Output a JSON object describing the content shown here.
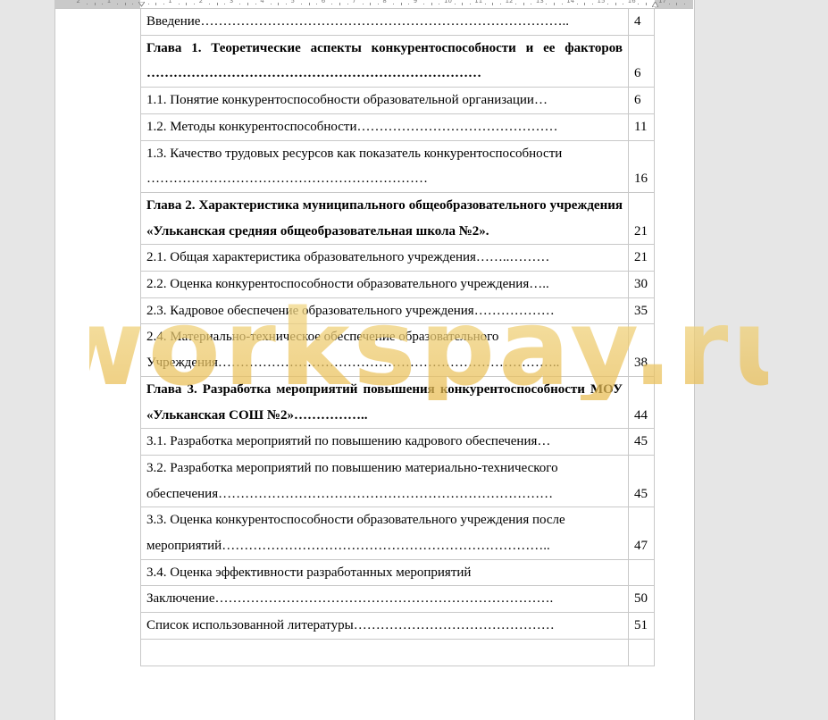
{
  "watermark": "workspay.ru",
  "ruler": {
    "numbers": [
      "2",
      "1",
      "1",
      "2",
      "3",
      "4",
      "5",
      "6",
      "7",
      "8",
      "9",
      "10",
      "11",
      "12",
      "13",
      "14",
      "15",
      "16",
      "17"
    ]
  },
  "toc": [
    {
      "text": "Введение………………………………………………………………………..",
      "page": "4",
      "bold": false,
      "tall": false
    },
    {
      "text": "Глава 1. Теоретические аспекты конкурентоспособности и ее факторов …………………………………………………………………",
      "page": "6",
      "bold": true,
      "tall": true
    },
    {
      "text": "1.1.    Понятие конкурентоспособности образовательной организации…",
      "page": "6",
      "bold": false,
      "tall": false
    },
    {
      "text": "1.2.    Методы конкурентоспособности………………………………………",
      "page": "11",
      "bold": false,
      "tall": false
    },
    {
      "text": "1.3.    Качество трудовых ресурсов как показатель конкурентоспособности ………………………………………………………",
      "page": "16",
      "bold": false,
      "tall": true
    },
    {
      "text": "Глава 2. Характеристика муниципального общеобразовательного учреждения «Ульканская средняя общеобразовательная школа №2».",
      "page": "21",
      "bold": true,
      "tall": true
    },
    {
      "text": "2.1.   Общая характеристика образовательного учреждения……..………",
      "page": "21",
      "bold": false,
      "tall": false
    },
    {
      "text": "2.2.  Оценка конкурентоспособности образовательного учреждения…..",
      "page": "30",
      "bold": false,
      "tall": false
    },
    {
      "text": "2.3.   Кадровое обеспечение образовательного учреждения………………",
      "page": "35",
      "bold": false,
      "tall": false
    },
    {
      "text": "2.4.   Материально-техническое обеспечение образовательного Учреждения…………………………………………………………………..",
      "page": "38",
      "bold": false,
      "tall": true
    },
    {
      "text": "Глава 3. Разработка мероприятий повышения конкурентоспособности МОУ «Ульканская СОШ №2»……………..",
      "page": "44",
      "bold": true,
      "tall": true
    },
    {
      "text": "3.1.   Разработка мероприятий по повышению кадрового обеспечения…",
      "page": "45",
      "bold": false,
      "tall": false
    },
    {
      "text": "3.2.   Разработка мероприятий по повышению материально-технического обеспечения…………………………………………………………………",
      "page": "45",
      "bold": false,
      "tall": true
    },
    {
      "text": "3.3.  Оценка конкурентоспособности образовательного учреждения после мероприятий………………………………………………………………..",
      "page": "47",
      "bold": false,
      "tall": true
    },
    {
      "text": "3.4. Оценка эффективности разработанных мероприятий",
      "page": "",
      "bold": false,
      "tall": false
    },
    {
      "text": "Заключение………………………………………………………………….",
      "page": "50",
      "bold": false,
      "tall": false
    },
    {
      "text": "Список использованной  литературы………………………………………",
      "page": "51",
      "bold": false,
      "tall": false
    },
    {
      "text": "",
      "page": "",
      "bold": false,
      "tall": false
    }
  ]
}
